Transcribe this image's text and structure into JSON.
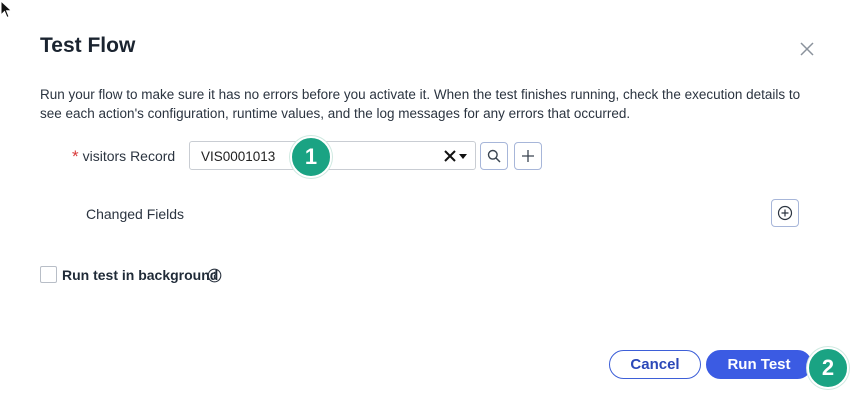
{
  "dialog": {
    "title": "Test Flow",
    "description": "Run your flow to make sure it has no errors before you activate it. When the test finishes running, check the execution details to see each action's configuration, runtime values, and the log messages for any errors that occurred.",
    "close_icon": "close-icon"
  },
  "record_field": {
    "required_mark": "*",
    "label": "visitors Record",
    "value": "VIS0001013",
    "icons": [
      "clear-icon",
      "chevron-down-icon",
      "search-icon",
      "plus-icon"
    ]
  },
  "changed_fields": {
    "label": "Changed Fields",
    "icon": "plus-circle-icon"
  },
  "background_option": {
    "label": "Run test in background",
    "checked": false,
    "icon": "info-icon"
  },
  "footer": {
    "cancel_label": "Cancel",
    "run_label": "Run Test"
  },
  "annotations": {
    "step1": "1",
    "step2": "2"
  },
  "colors": {
    "primary": "#3b5be3",
    "required": "#d93a3a",
    "badge": "#1aa383"
  }
}
